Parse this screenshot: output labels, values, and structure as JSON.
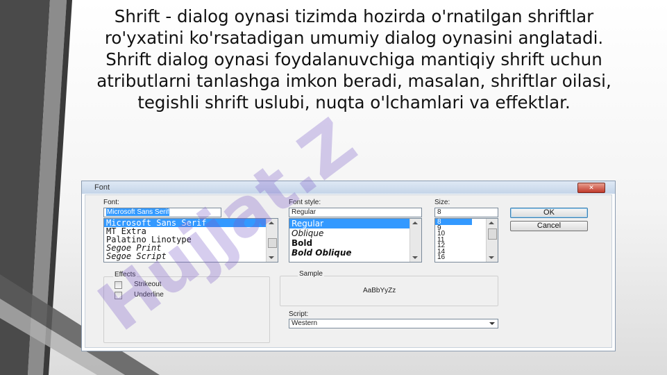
{
  "slide": {
    "text": "Shrift - dialog oynasi tizimda hozirda o'rnatilgan shriftlar ro'yxatini  ko'rsatadigan umumiy dialog oynasini anglatadi. Shrift dialog oynasi foydalanuvchiga mantiqiy shrift uchun atributlarni tanlashga imkon beradi, masalan, shriftlar oilasi, tegishli shrift uslubi, nuqta o'lchamlari va effektlar.",
    "watermark": "Hujjat.Z"
  },
  "dialog": {
    "title": "Font",
    "close_icon": "close-icon",
    "font": {
      "label": "Font:",
      "value": "Microsoft Sans Serif",
      "items": [
        "Microsoft Sans Serif",
        "MT Extra",
        "Palatino Linotype",
        "Segoe Print",
        "Segoe Script"
      ],
      "selected_index": 0
    },
    "style": {
      "label": "Font style:",
      "value": "Regular",
      "items": [
        "Regular",
        "Oblique",
        "Bold",
        "Bold Oblique"
      ],
      "selected_index": 0
    },
    "size": {
      "label": "Size:",
      "value": "8",
      "items": [
        "8",
        "9",
        "10",
        "11",
        "12",
        "14",
        "16"
      ],
      "selected_index": 0
    },
    "ok_label": "OK",
    "cancel_label": "Cancel",
    "effects": {
      "label": "Effects",
      "strikeout": "Strikeout",
      "underline": "Underline"
    },
    "sample": {
      "label": "Sample",
      "text": "AaBbYyZz"
    },
    "script": {
      "label": "Script:",
      "value": "Western"
    }
  },
  "colors": {
    "selection": "#3399ff",
    "stripe_dark": "#3a3a3a",
    "stripe_light": "#9a9a9a",
    "watermark": "#7a5cc8"
  }
}
